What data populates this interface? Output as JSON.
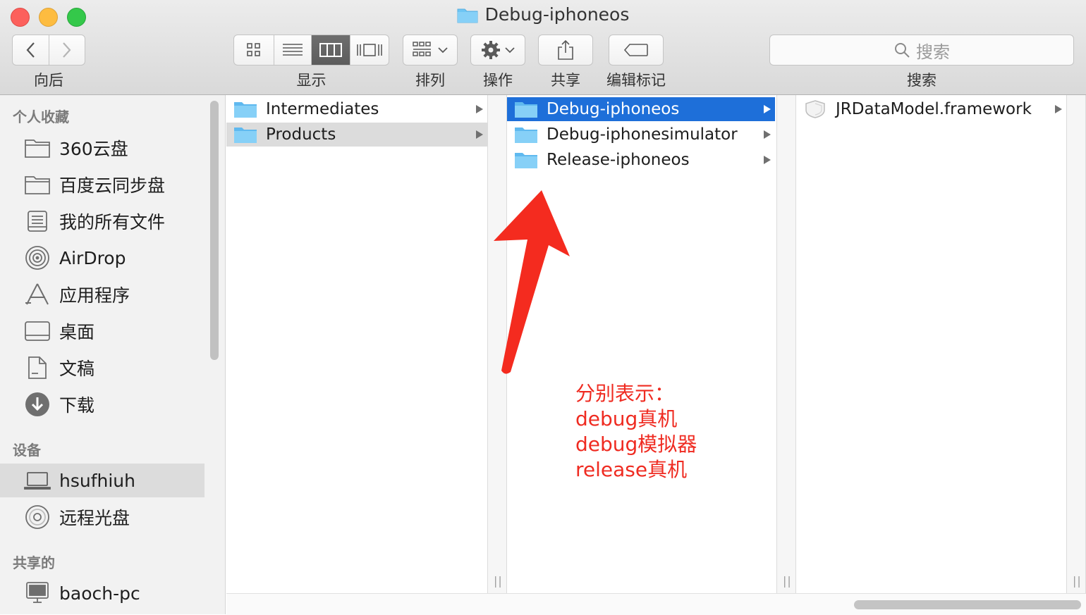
{
  "window": {
    "title": "Debug-iphoneos"
  },
  "toolbar": {
    "nav_label": "向后",
    "view_label": "显示",
    "arrange_label": "排列",
    "action_label": "操作",
    "share_label": "共享",
    "tags_label": "编辑标记",
    "search_label": "搜索",
    "search_placeholder": "搜索",
    "active_view": "column"
  },
  "sidebar": {
    "favorites_header": "个人收藏",
    "favorites": [
      {
        "label": "360云盘",
        "icon": "folder-icon"
      },
      {
        "label": "百度云同步盘",
        "icon": "folder-icon"
      },
      {
        "label": "我的所有文件",
        "icon": "all-files-icon"
      },
      {
        "label": "AirDrop",
        "icon": "airdrop-icon"
      },
      {
        "label": "应用程序",
        "icon": "applications-icon"
      },
      {
        "label": "桌面",
        "icon": "desktop-icon"
      },
      {
        "label": "文稿",
        "icon": "documents-icon"
      },
      {
        "label": "下载",
        "icon": "downloads-icon"
      }
    ],
    "devices_header": "设备",
    "devices": [
      {
        "label": "hsufhiuh",
        "icon": "laptop-icon",
        "selected": true
      },
      {
        "label": "远程光盘",
        "icon": "optical-disc-icon"
      }
    ],
    "shared_header": "共享的",
    "shared": [
      {
        "label": "baoch-pc",
        "icon": "pc-icon"
      }
    ]
  },
  "columns": {
    "col1": [
      {
        "name": "Intermediates"
      },
      {
        "name": "Products",
        "state": "parent-selected"
      }
    ],
    "col2": [
      {
        "name": "Debug-iphoneos",
        "state": "selected"
      },
      {
        "name": "Debug-iphonesimulator"
      },
      {
        "name": "Release-iphoneos"
      }
    ],
    "col3": [
      {
        "name": "JRDataModel.framework",
        "icon": "framework-icon"
      }
    ]
  },
  "annotation": {
    "lines": [
      "分别表示：",
      "debug真机",
      "debug模拟器",
      "release真机"
    ],
    "color": "#ef2b21"
  },
  "colors": {
    "selection": "#1e6fd9",
    "folder": "#6ec5f4"
  }
}
